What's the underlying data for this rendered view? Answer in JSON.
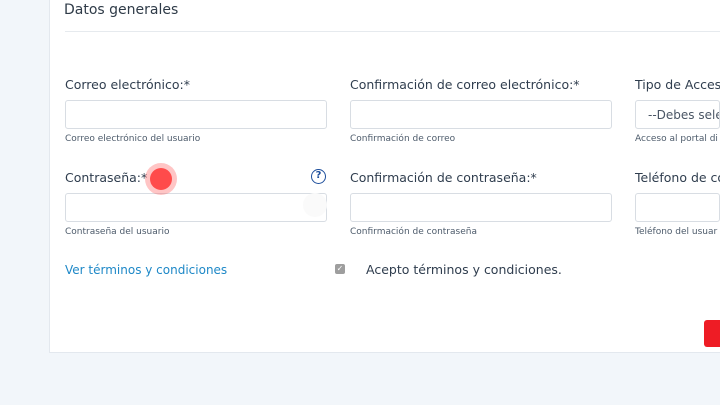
{
  "section": {
    "title": "Datos generales"
  },
  "fields": {
    "email": {
      "label": "Correo electrónico:*",
      "value": "",
      "help": "Correo electrónico del usuario"
    },
    "email_confirm": {
      "label": "Confirmación de correo electrónico:*",
      "value": "",
      "help": "Confirmación de correo"
    },
    "access_type": {
      "label": "Tipo de Acceso",
      "selected": "--Debes sele",
      "help": "Acceso al portal di"
    },
    "password": {
      "label": "Contraseña:*",
      "value": "",
      "help": "Contraseña del usuario"
    },
    "password_confirm": {
      "label": "Confirmación de contraseña:*",
      "value": "",
      "help": "Confirmación de contraseña"
    },
    "phone": {
      "label": "Teléfono de co",
      "value": "",
      "help": "Teléfono del usuar"
    }
  },
  "help_icon": {
    "glyph": "?",
    "icon": "question-circle-icon"
  },
  "terms": {
    "link": "Ver términos y condiciones",
    "checkbox_checked": true,
    "checkbox_glyph": "✓",
    "accept_label": "Acepto términos y condiciones."
  },
  "colors": {
    "accent": "#1e88c7",
    "danger": "#ee1c25",
    "click_indicator": "#ff4b4b"
  }
}
